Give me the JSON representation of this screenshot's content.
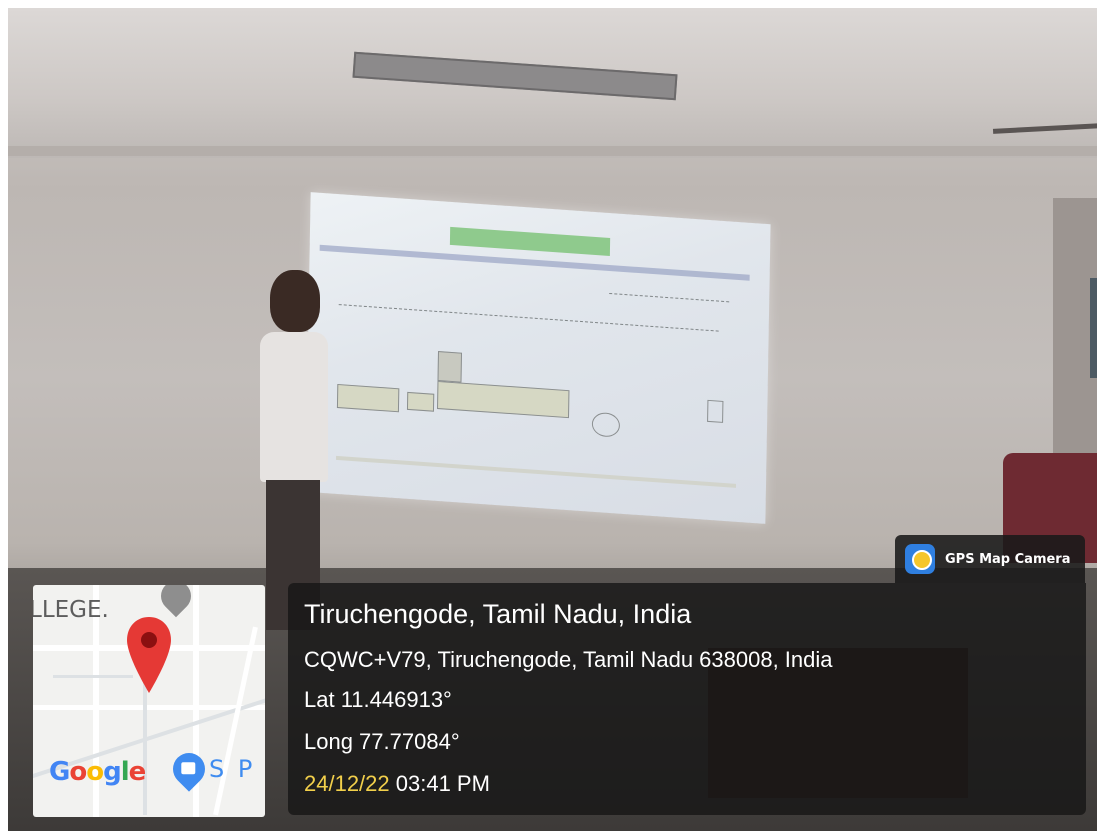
{
  "gps_badge": {
    "app_name": "GPS Map Camera",
    "icon": "gps-map-camera-icon"
  },
  "map": {
    "place_label": "LLEGE.",
    "logo_text": "Google",
    "shop_label": "S P",
    "pin_color": "#e53935"
  },
  "location": {
    "title": "Tiruchengode, Tamil Nadu, India",
    "address": "CQWC+V79, Tiruchengode, Tamil Nadu 638008, India",
    "latitude": "Lat 11.446913°",
    "longitude": "Long 77.77084°",
    "date": "24/12/22",
    "time": "03:41 PM"
  },
  "colors": {
    "date": "#f2d04b",
    "overlay": "#141414",
    "slide_banner": "#8fca8d"
  }
}
